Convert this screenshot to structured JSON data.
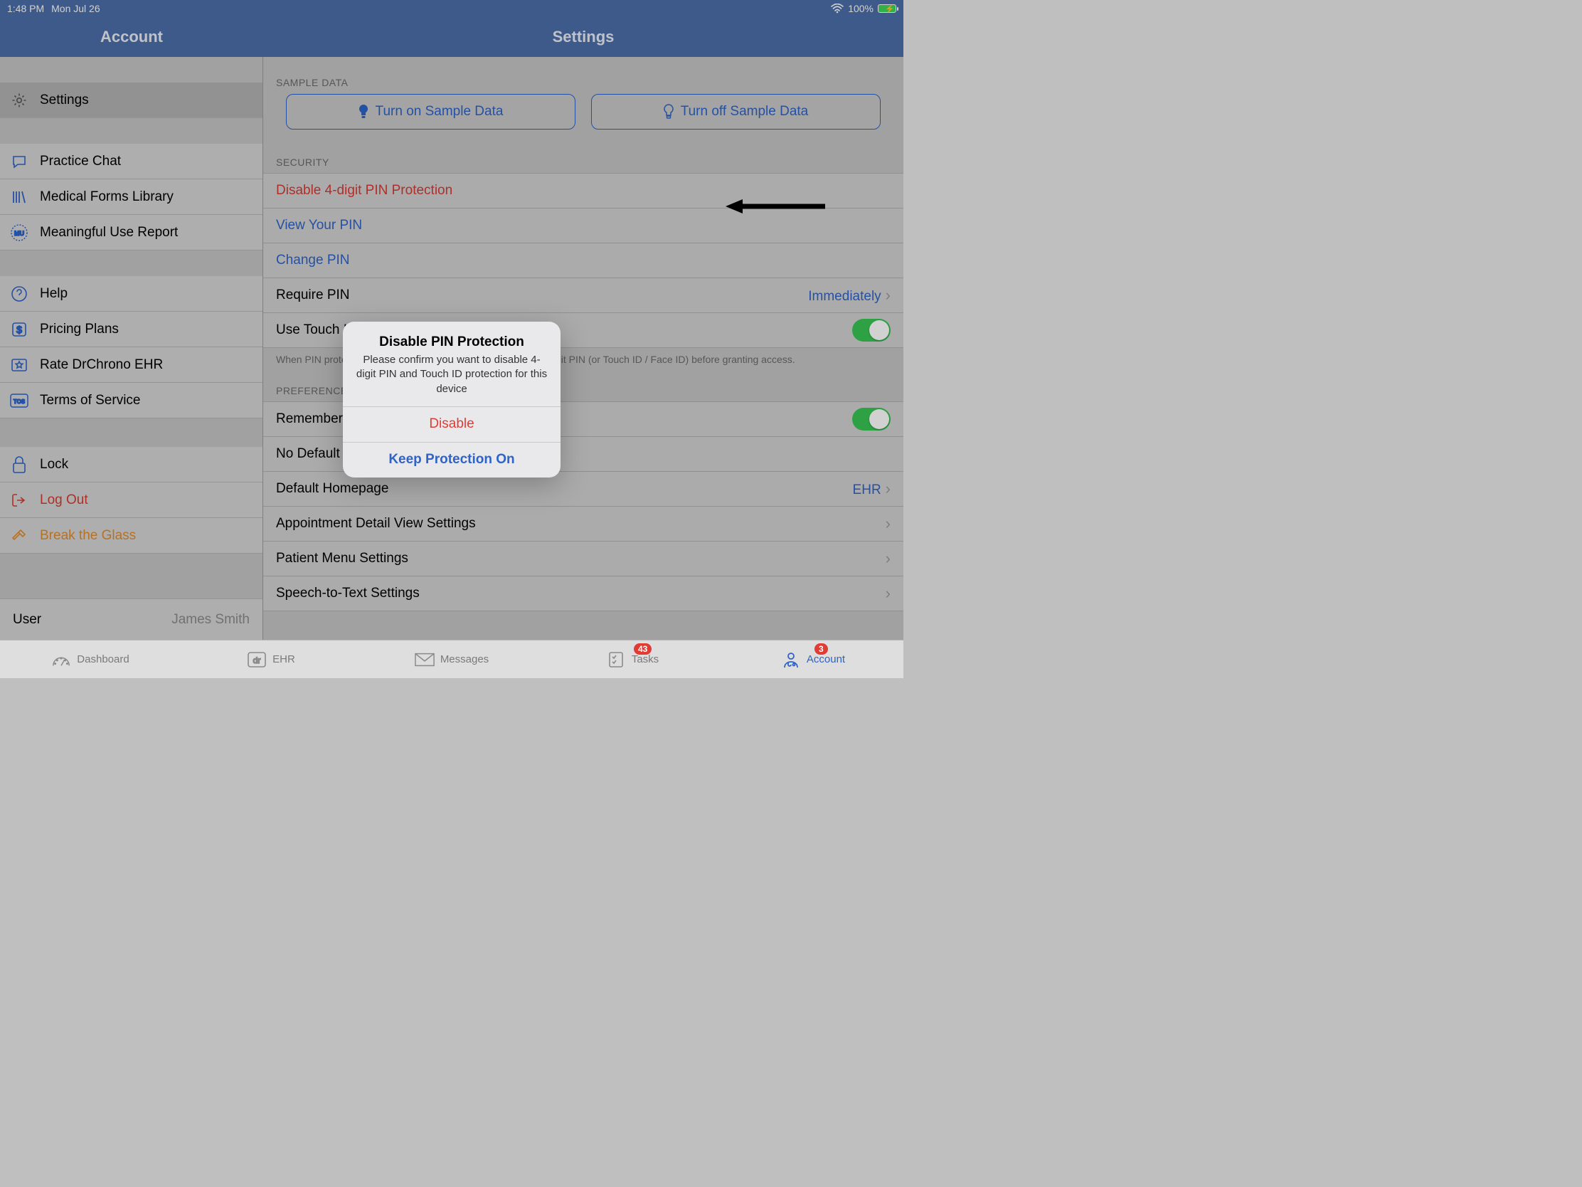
{
  "status": {
    "time": "1:48 PM",
    "date": "Mon Jul 26",
    "battery_pct": "100%"
  },
  "nav": {
    "left_title": "Account",
    "right_title": "Settings"
  },
  "sidebar": {
    "groups": [
      {
        "items": [
          {
            "label": "Settings",
            "icon": "gear"
          }
        ]
      },
      {
        "items": [
          {
            "label": "Practice Chat",
            "icon": "chat"
          },
          {
            "label": "Medical Forms Library",
            "icon": "books"
          },
          {
            "label": "Meaningful Use Report",
            "icon": "mu"
          }
        ]
      },
      {
        "items": [
          {
            "label": "Help",
            "icon": "question"
          },
          {
            "label": "Pricing Plans",
            "icon": "dollar"
          },
          {
            "label": "Rate DrChrono EHR",
            "icon": "starbox"
          },
          {
            "label": "Terms of Service",
            "icon": "tos"
          }
        ]
      },
      {
        "items": [
          {
            "label": "Lock",
            "icon": "lock"
          },
          {
            "label": "Log Out",
            "icon": "logout",
            "style": "logout"
          },
          {
            "label": "Break the Glass",
            "icon": "hammer",
            "style": "break"
          }
        ]
      }
    ],
    "user_label": "User",
    "user_value": "James Smith"
  },
  "content": {
    "sample": {
      "header": "SAMPLE DATA",
      "on": "Turn on Sample Data",
      "off": "Turn off Sample Data"
    },
    "security": {
      "header": "SECURITY",
      "disable_pin": "Disable 4-digit PIN Protection",
      "view_pin": "View Your PIN",
      "change_pin": "Change PIN",
      "require_pin_label": "Require PIN",
      "require_pin_value": "Immediately",
      "touch_id": "Use Touch ID",
      "footnote": "When PIN protection is enabled, DrChrono will ask for your 4-digit PIN (or Touch ID / Face ID) before granting access."
    },
    "prefs": {
      "header": "PREFERENCES",
      "remember": "Remember Last Chart Position",
      "no_template": "No Default Template - Set at drchrono.com",
      "homepage_label": "Default Homepage",
      "homepage_value": "EHR",
      "appt_detail": "Appointment Detail View Settings",
      "patient_menu": "Patient Menu Settings",
      "speech": "Speech-to-Text Settings"
    }
  },
  "modal": {
    "title": "Disable PIN Protection",
    "message": "Please confirm you want to disable 4-digit PIN and Touch ID protection for this device",
    "disable": "Disable",
    "keep": "Keep Protection On"
  },
  "tabs": {
    "dashboard": "Dashboard",
    "ehr": "EHR",
    "messages": "Messages",
    "tasks": "Tasks",
    "tasks_badge": "43",
    "account": "Account",
    "account_badge": "3"
  }
}
